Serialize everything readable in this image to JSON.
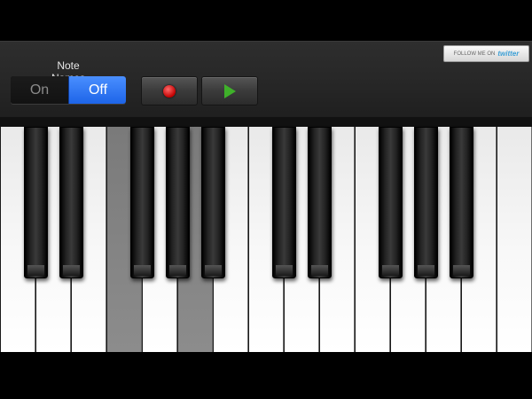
{
  "toolbar": {
    "note_names_label": "Note Names",
    "toggle_on_label": "On",
    "toggle_off_label": "Off",
    "selected": "Off",
    "record_icon": "record-icon",
    "play_icon": "play-icon"
  },
  "twitter_button": {
    "prefix": "FOLLOW ME ON",
    "brand": "twitter"
  },
  "colors": {
    "toggle_selected": "#2f7bf5",
    "record": "#d10000",
    "play": "#3fb12a",
    "pressed_key": "#808080"
  },
  "keyboard": {
    "white_key_count": 15,
    "pressed_white_keys": [
      3,
      5
    ]
  }
}
